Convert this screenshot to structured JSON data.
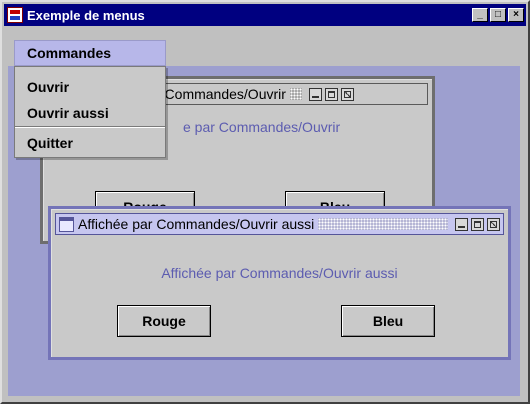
{
  "window": {
    "title": "Exemple de menus",
    "icon": "java-cup-icon",
    "controls": [
      "minimize-icon",
      "maximize-icon",
      "close-icon"
    ]
  },
  "menubar": {
    "menus": [
      {
        "label": "Commandes",
        "open": true
      }
    ]
  },
  "dropdown": {
    "items": [
      {
        "label": "Ouvrir"
      },
      {
        "label": "Ouvrir aussi"
      },
      {
        "label": "Quitter"
      }
    ]
  },
  "frames": [
    {
      "title": "Affichée par Commandes/Ouvrir",
      "title_visible": "r Commandes/Ouvrir",
      "label": "Affichée par Commandes/Ouvrir",
      "label_visible": "e par Commandes/Ouvrir",
      "buttons": [
        "Rouge",
        "Bleu"
      ]
    },
    {
      "title": "Affichée par Commandes/Ouvrir aussi",
      "label": "Affichée par Commandes/Ouvrir aussi",
      "buttons": [
        "Rouge",
        "Bleu"
      ]
    }
  ],
  "colors": {
    "titlebar": "#000080",
    "desktop": "#9d9fcf",
    "label_text": "#5c5cb0",
    "menu_highlight": "#b7b7e9"
  }
}
